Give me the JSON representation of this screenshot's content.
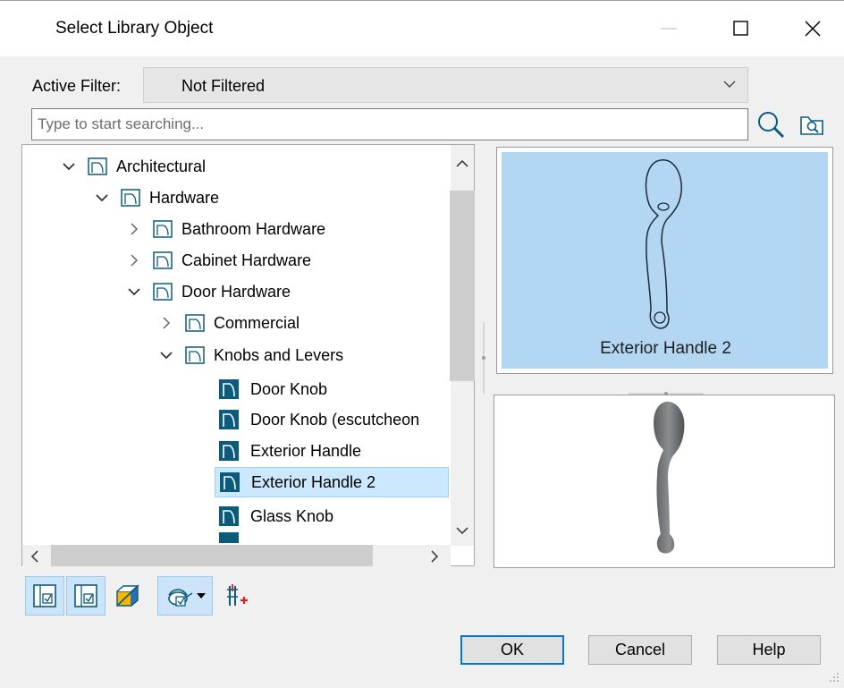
{
  "window": {
    "title": "Select Library Object",
    "controls": [
      "minimize-icon",
      "maximize-icon",
      "close-icon"
    ]
  },
  "filter": {
    "label": "Active Filter:",
    "value": "Not Filtered"
  },
  "search": {
    "placeholder": "Type to start searching..."
  },
  "tree": {
    "items": [
      {
        "label": "Architectural",
        "level": 0,
        "state": "expanded",
        "type": "folder"
      },
      {
        "label": "Hardware",
        "level": 1,
        "state": "expanded",
        "type": "folder"
      },
      {
        "label": "Bathroom Hardware",
        "level": 2,
        "state": "collapsed",
        "type": "folder"
      },
      {
        "label": "Cabinet Hardware",
        "level": 2,
        "state": "collapsed",
        "type": "folder"
      },
      {
        "label": "Door Hardware",
        "level": 2,
        "state": "expanded",
        "type": "folder"
      },
      {
        "label": "Commercial",
        "level": 3,
        "state": "collapsed",
        "type": "folder"
      },
      {
        "label": "Knobs and Levers",
        "level": 3,
        "state": "expanded",
        "type": "folder"
      },
      {
        "label": "Door Knob",
        "level": 4,
        "type": "object"
      },
      {
        "label": "Door Knob (escutcheon",
        "level": 4,
        "type": "object"
      },
      {
        "label": "Exterior Handle",
        "level": 4,
        "type": "object"
      },
      {
        "label": "Exterior Handle 2",
        "level": 4,
        "type": "object",
        "selected": true
      },
      {
        "label": "Glass Knob",
        "level": 4,
        "type": "object"
      }
    ]
  },
  "preview": {
    "selected_name": "Exterior Handle 2"
  },
  "buttons": {
    "ok": "OK",
    "cancel": "Cancel",
    "help": "Help"
  },
  "colors": {
    "accent": "#0078d7",
    "selection": "#cce8ff",
    "preview_bg": "#b3d7f3",
    "folder_icon": "#0b5b7c"
  }
}
